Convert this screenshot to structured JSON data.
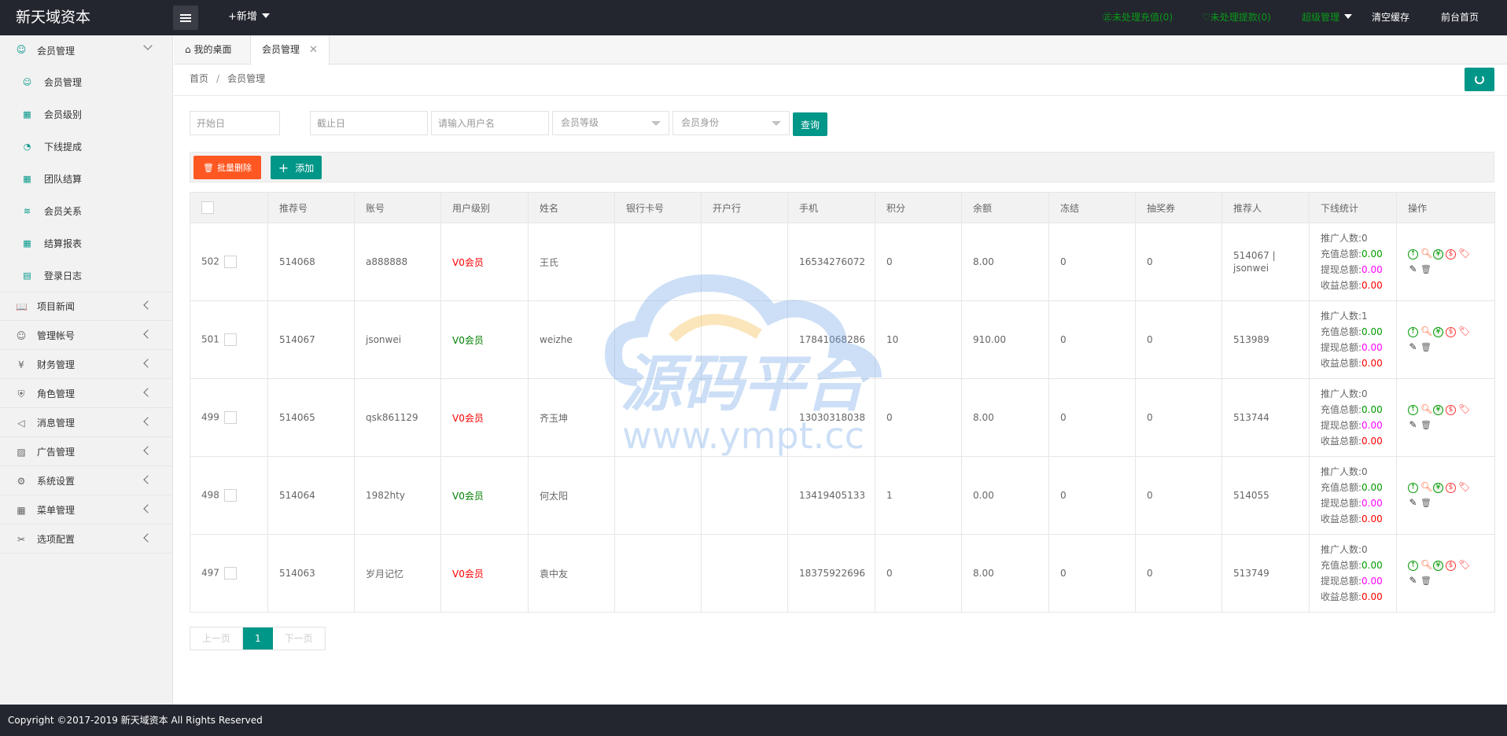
{
  "header": {
    "brand": "新天域资本",
    "new_label": "+新增",
    "unprocessed_recharge": "㊣未处理充值(0)",
    "unprocessed_withdraw": "♡未处理提款(0)",
    "super_admin": "超级管理",
    "clear_cache": "清空缓存",
    "frontend_home": "前台首页"
  },
  "sidebar": {
    "member_group": "会员管理",
    "sub_items": [
      {
        "label": "会员管理",
        "icon": "user-icon"
      },
      {
        "label": "会员级别",
        "icon": "grid-icon"
      },
      {
        "label": "下线提成",
        "icon": "dashboard-icon"
      },
      {
        "label": "团队结算",
        "icon": "grid-icon"
      },
      {
        "label": "会员关系",
        "icon": "wifi-icon"
      },
      {
        "label": "结算报表",
        "icon": "grid-icon"
      },
      {
        "label": "登录日志",
        "icon": "calendar-icon"
      }
    ],
    "groups": [
      {
        "label": "项目新闻",
        "icon": "book-icon"
      },
      {
        "label": "管理帐号",
        "icon": "users-icon"
      },
      {
        "label": "财务管理",
        "icon": "yen-icon"
      },
      {
        "label": "角色管理",
        "icon": "shield-icon"
      },
      {
        "label": "消息管理",
        "icon": "speaker-icon"
      },
      {
        "label": "广告管理",
        "icon": "image-icon"
      },
      {
        "label": "系统设置",
        "icon": "gear-icon"
      },
      {
        "label": "菜单管理",
        "icon": "apps-icon"
      },
      {
        "label": "选项配置",
        "icon": "tools-icon"
      }
    ]
  },
  "tabs": {
    "home": "我的桌面",
    "members": "会员管理"
  },
  "breadcrumb": {
    "home": "首页",
    "sep": "/",
    "current": "会员管理"
  },
  "filters": {
    "start_date": "开始日",
    "end_date": "截止日",
    "username": "请输入用户名",
    "level": "会员等级",
    "identity": "会员身份",
    "query": "查询"
  },
  "toolbar": {
    "batch_delete": "批量删除",
    "add": "添加"
  },
  "table": {
    "headers": [
      "",
      "推荐号",
      "账号",
      "用户级别",
      "姓名",
      "银行卡号",
      "开户行",
      "手机",
      "积分",
      "余额",
      "冻结",
      "抽奖券",
      "推荐人",
      "下线统计",
      "操作"
    ],
    "stat_labels": {
      "promoted": "推广人数:",
      "recharge": "充值总额:",
      "withdraw": "提现总额:",
      "income": "收益总额:"
    },
    "rows": [
      {
        "id": "502",
        "ref": "514068",
        "account": "a888888",
        "level": "V0会员",
        "level_color": "#ff0000",
        "name": "王氏",
        "bank": "",
        "branch": "",
        "phone": "16534276072",
        "points": "0",
        "balance": "8.00",
        "frozen": "0",
        "tickets": "0",
        "referrer": "514067 | jsonwei",
        "promoted": "0",
        "recharge": "0.00",
        "withdraw": "0.00",
        "income": "0.00"
      },
      {
        "id": "501",
        "ref": "514067",
        "account": "jsonwei",
        "level": "V0会员",
        "level_color": "#008000",
        "name": "weizhe",
        "bank": "",
        "branch": "",
        "phone": "17841068286",
        "points": "10",
        "balance": "910.00",
        "frozen": "0",
        "tickets": "0",
        "referrer": "513989",
        "promoted": "1",
        "recharge": "0.00",
        "withdraw": "0.00",
        "income": "0.00"
      },
      {
        "id": "499",
        "ref": "514065",
        "account": "qsk861129",
        "level": "V0会员",
        "level_color": "#ff0000",
        "name": "齐玉坤",
        "bank": "",
        "branch": "",
        "phone": "13030318038",
        "points": "0",
        "balance": "8.00",
        "frozen": "0",
        "tickets": "0",
        "referrer": "513744",
        "promoted": "0",
        "recharge": "0.00",
        "withdraw": "0.00",
        "income": "0.00"
      },
      {
        "id": "498",
        "ref": "514064",
        "account": "1982hty",
        "level": "V0会员",
        "level_color": "#008000",
        "name": "何太阳",
        "bank": "",
        "branch": "",
        "phone": "13419405133",
        "points": "1",
        "balance": "0.00",
        "frozen": "0",
        "tickets": "0",
        "referrer": "514055",
        "promoted": "0",
        "recharge": "0.00",
        "withdraw": "0.00",
        "income": "0.00"
      },
      {
        "id": "497",
        "ref": "514063",
        "account": "岁月记忆",
        "level": "V0会员",
        "level_color": "#ff0000",
        "name": "袁中友",
        "bank": "",
        "branch": "",
        "phone": "18375922696",
        "points": "0",
        "balance": "8.00",
        "frozen": "0",
        "tickets": "0",
        "referrer": "513749",
        "promoted": "0",
        "recharge": "0.00",
        "withdraw": "0.00",
        "income": "0.00"
      }
    ]
  },
  "pagination": {
    "prev": "上一页",
    "current": "1",
    "next": "下一页"
  },
  "watermark": {
    "title": "源码平台",
    "url": "www.ympt.cc"
  },
  "footer": {
    "copyright": "Copyright ©2017-2019 新天域资本 All Rights Reserved"
  },
  "colors": {
    "header_bg": "#23262e",
    "accent": "#009688",
    "danger": "#ff5722"
  }
}
